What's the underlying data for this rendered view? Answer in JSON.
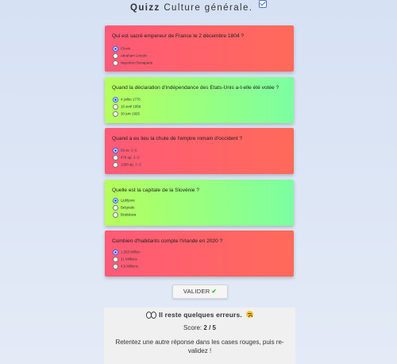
{
  "header": {
    "title_bold": "Quizz",
    "title_rest": "Culture générale."
  },
  "questions": [
    {
      "text": "Qui est sacré empereur de France le 2 décembre 1804 ?",
      "state": "wrong",
      "options": [
        {
          "label": "Clovis",
          "checked": true
        },
        {
          "label": "Abraham Lincoln",
          "checked": false
        },
        {
          "label": "Napoléon Bonaparte",
          "checked": false
        }
      ]
    },
    {
      "text": "Quand la déclaration d'indépendance des Etats-Unis a-t-elle été votée ?",
      "state": "correct",
      "options": [
        {
          "label": "4 juillet 1776",
          "checked": true
        },
        {
          "label": "16 avril 1858",
          "checked": false
        },
        {
          "label": "30 juin 1925",
          "checked": false
        }
      ]
    },
    {
      "text": "Quand a eu lieu la chute de l'empire romain d'occident ?",
      "state": "wrong",
      "options": [
        {
          "label": "59 av. J.-C",
          "checked": true
        },
        {
          "label": "476 ap. J.-C",
          "checked": false
        },
        {
          "label": "1200 ap. J.-C",
          "checked": false
        }
      ]
    },
    {
      "text": "Quelle est la capitale de la Slovénie ?",
      "state": "correct",
      "options": [
        {
          "label": "Ljubljana",
          "checked": true
        },
        {
          "label": "Belgrade",
          "checked": false
        },
        {
          "label": "Bratislava",
          "checked": false
        }
      ]
    },
    {
      "text": "Combien d'habitants compte l'Irlande en 2020 ?",
      "state": "wrong",
      "options": [
        {
          "label": "1,363 Million",
          "checked": true
        },
        {
          "label": "21 Millions",
          "checked": false
        },
        {
          "label": "4,9 Millions",
          "checked": false
        }
      ]
    }
  ],
  "submit_button": {
    "label": "VALIDER"
  },
  "result": {
    "title": "Il reste quelques erreurs.",
    "score_label": "Score:",
    "score_value": "2 / 5",
    "message": "Retentez une autre réponse dans les cases rouges, puis re-validez !"
  },
  "colors": {
    "wrong": "#ff5f6d",
    "correct": "#8dff8f",
    "accent": "#2a5ee8"
  },
  "icons": {
    "header": "checkbox-checked-icon",
    "title_left": "eyes-emoji-icon",
    "title_right": "crying-face-emoji-icon",
    "submit": "check-mark-icon"
  }
}
